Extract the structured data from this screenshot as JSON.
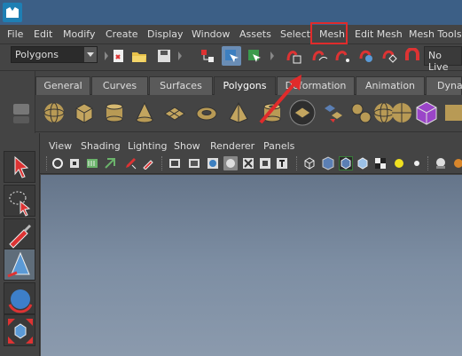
{
  "menubar": {
    "items": [
      "File",
      "Edit",
      "Modify",
      "Create",
      "Display",
      "Window",
      "Assets",
      "Select",
      "Mesh",
      "Edit Mesh",
      "Mesh Tools"
    ],
    "highlighted": "Mesh",
    "highlight_color": "#e02b2b"
  },
  "statusline": {
    "mode_selector_value": "Polygons",
    "live_field_value": "No Live",
    "icons": [
      "new-scene-icon",
      "open-scene-icon",
      "save-scene-icon",
      "select-hierarchy-icon",
      "select-object-icon",
      "select-component-icon",
      "snap-grid-icon",
      "snap-curve-icon",
      "snap-point-icon",
      "snap-view-plane-icon",
      "make-live-icon",
      "magnet-icon"
    ]
  },
  "shelf": {
    "tabs": [
      "General",
      "Curves",
      "Surfaces",
      "Polygons",
      "Deformation",
      "Animation",
      "Dynar"
    ],
    "active_tab": "Polygons",
    "icons": [
      "poly-sphere-icon",
      "poly-cube-icon",
      "poly-cylinder-icon",
      "poly-cone-icon",
      "poly-plane-icon",
      "poly-torus-icon",
      "poly-pyramid-icon",
      "poly-pipe-icon",
      "poly-platonic-icon",
      "poly-combine-icon",
      "poly-separate-icon",
      "poly-smooth-icon",
      "poly-extract-icon",
      "poly-booleans-icon"
    ]
  },
  "toolbox": {
    "tools": [
      "select-tool-icon",
      "lasso-tool-icon",
      "paint-select-tool-icon",
      "move-tool-icon",
      "rotate-tool-icon",
      "scale-tool-icon"
    ]
  },
  "panel": {
    "menus": [
      "View",
      "Shading",
      "Lighting",
      "Show",
      "Renderer",
      "Panels"
    ],
    "toolbar_icons": [
      "camera-attributes-icon",
      "bookmark-icon",
      "image-plane-icon",
      "2d-pan-zoom-icon",
      "grease-pencil-icon",
      "grid-icon",
      "film-gate-icon",
      "resolution-gate-icon",
      "gate-mask-icon",
      "field-chart-icon",
      "safe-action-icon",
      "safe-title-icon",
      "wireframe-icon",
      "smooth-shade-icon",
      "shaded-wireframe-icon",
      "default-material-icon",
      "textured-icon",
      "lights-icon",
      "shadows-icon",
      "ambient-occlusion-icon"
    ]
  },
  "colors": {
    "title_bar": "#3c5f86",
    "ui_background": "#444444",
    "viewport_top": "#65758a",
    "viewport_bottom": "#8b9aad",
    "annotation_red": "#e02b2b"
  }
}
